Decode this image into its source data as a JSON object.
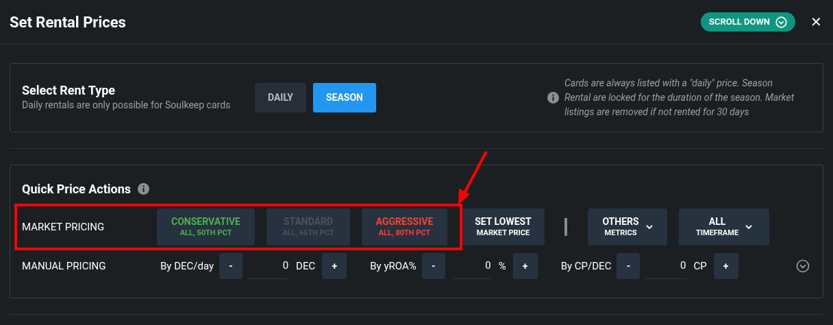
{
  "header": {
    "title": "Set Rental Prices",
    "scroll_button": "SCROLL DOWN",
    "close": "✕"
  },
  "rent_type": {
    "title": "Select Rent Type",
    "subtitle": "Daily rentals are only possible for Soulkeep cards",
    "options": [
      {
        "label": "DAILY",
        "selected": false
      },
      {
        "label": "SEASON",
        "selected": true
      }
    ],
    "info": "Cards are always listed with a \"daily\" price. Season Rental are locked for the duration of the season. Market listings are removed if not rented for 30 days"
  },
  "quick_actions": {
    "title": "Quick Price Actions",
    "market_pricing": {
      "label": "MARKET PRICING",
      "presets": [
        {
          "label": "CONSERVATIVE",
          "sub": "ALL, 50TH PCT",
          "color": "#4caf50"
        },
        {
          "label": "STANDARD",
          "sub": "ALL, 66TH PCT",
          "color": "#4a525b"
        },
        {
          "label": "AGGRESSIVE",
          "sub": "ALL, 80TH PCT",
          "color": "#f44336"
        }
      ],
      "set_lowest": {
        "label": "SET LOWEST",
        "sub": "MARKET PRICE"
      },
      "dropdowns": [
        {
          "label": "OTHERS",
          "sub": "METRICS"
        },
        {
          "label": "ALL",
          "sub": "TIMEFRAME"
        }
      ]
    },
    "manual_pricing": {
      "label": "MANUAL PRICING",
      "groups": [
        {
          "label": "By DEC/day",
          "minus": "-",
          "value": "0",
          "unit": "DEC",
          "plus": "+"
        },
        {
          "label": "By yROA%",
          "minus": "-",
          "value": "0",
          "unit": "%",
          "plus": "+"
        },
        {
          "label": "By CP/DEC",
          "minus": "-",
          "value": "0",
          "unit": "CP",
          "plus": "+"
        }
      ]
    }
  }
}
